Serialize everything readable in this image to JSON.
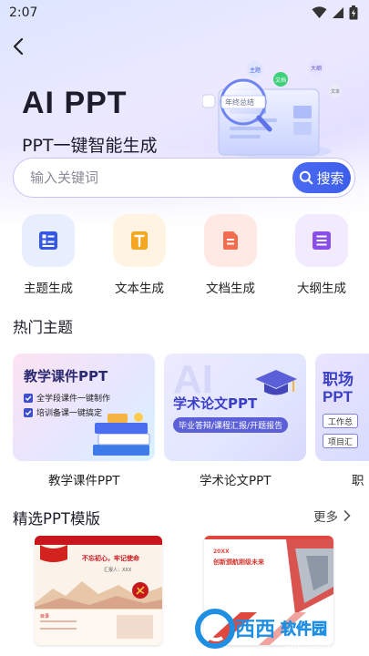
{
  "status_bar": {
    "time": "2:07"
  },
  "hero": {
    "title": "AI PPT",
    "subtitle": "PPT一键智能生成",
    "illustration": {
      "search_text": "年终总结",
      "bubbles": [
        "主题",
        "大纲",
        "文档",
        "文本"
      ]
    }
  },
  "search": {
    "placeholder": "输入关键词",
    "button_label": "搜索"
  },
  "features": [
    {
      "label": "主题生成",
      "icon": "theme-grid-icon",
      "tile_bg": "#e9eeff",
      "icon_color": "#3557e6"
    },
    {
      "label": "文本生成",
      "icon": "text-doc-icon",
      "tile_bg": "#fff4e2",
      "icon_color": "#f5a623"
    },
    {
      "label": "文档生成",
      "icon": "document-icon",
      "tile_bg": "#ffe9e4",
      "icon_color": "#f26d4f"
    },
    {
      "label": "大纲生成",
      "icon": "outline-list-icon",
      "tile_bg": "#f2ebff",
      "icon_color": "#8a4fe8"
    }
  ],
  "hot_topics": {
    "title": "热门主题",
    "cards": [
      {
        "caption": "教学课件PPT",
        "headline": "教学课件PPT",
        "bullets": [
          "全学段课件一键制作",
          "培训备课一键搞定"
        ]
      },
      {
        "caption": "学术论文PPT",
        "headline": "学术论文PPT",
        "tag": "毕业答辩/课程汇报/开题报告",
        "bg_word": "AI"
      },
      {
        "caption": "职",
        "headline": "职场",
        "headline2": "PPT",
        "tags": [
          "工作总",
          "项目汇"
        ]
      }
    ]
  },
  "templates": {
    "title": "精选PPT模版",
    "more_label": "更多",
    "cards": [
      {
        "title": "不忘初心，牢记使命",
        "sub": "汇报人：XXX",
        "section": "目录"
      },
      {
        "year": "20XX",
        "title": "创新颁航刚级未来"
      }
    ]
  },
  "watermark": {
    "brand": "西西",
    "text": "软件园",
    "domain": "CR173.COM"
  },
  "colors": {
    "accent": "#3d5ee9",
    "search_border": "#c9c3f3",
    "title_text": "#1c1c2a",
    "party_red": "#c8161d"
  }
}
